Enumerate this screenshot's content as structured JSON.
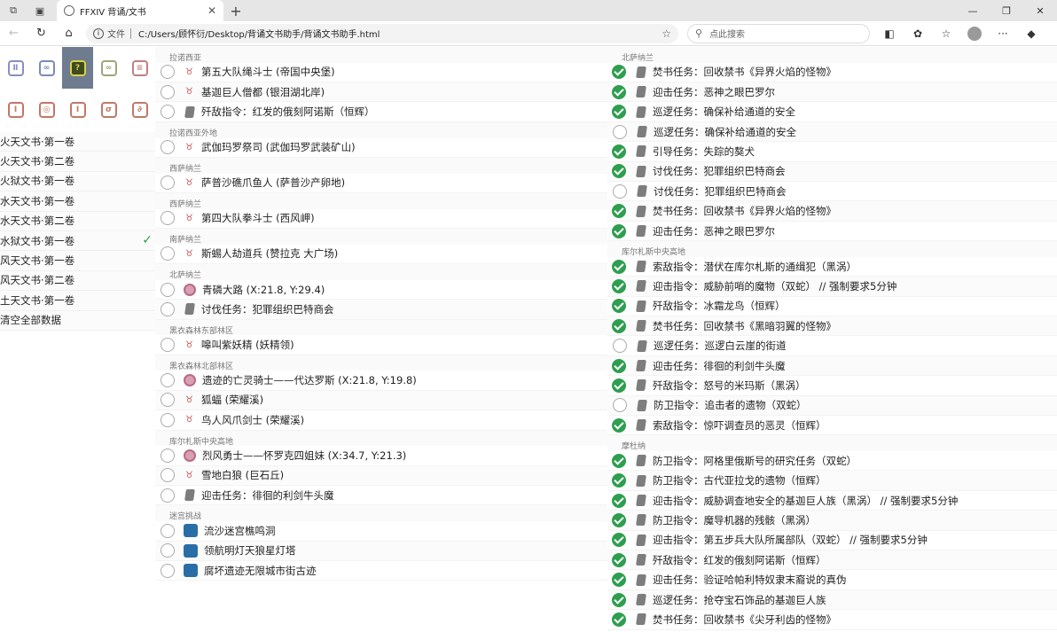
{
  "browser": {
    "tab_title": "FFXIV 背诵/文书",
    "tab_close": "✕",
    "new_tab": "+",
    "address_label": "文件",
    "url": "C:/Users/顾怀衍/Desktop/背诵文书助手/背诵文书助手.html",
    "search_placeholder": "点此搜索"
  },
  "classes_row1": [
    {
      "name": "paladin",
      "glyph": "Ⅱ",
      "color": "#8a8fc0"
    },
    {
      "name": "warrior",
      "glyph": "∞",
      "color": "#7b8ab8"
    },
    {
      "name": "selected",
      "glyph": "?",
      "color": "#d6d24a"
    },
    {
      "name": "gunbreaker",
      "glyph": "∞",
      "color": "#9ca77c"
    },
    {
      "name": "dancer",
      "glyph": "≡",
      "color": "#c08080"
    }
  ],
  "classes_row2": [
    {
      "name": "monk",
      "glyph": "Ⅰ",
      "color": "#c07868"
    },
    {
      "name": "dragoon",
      "glyph": "◎",
      "color": "#c07868"
    },
    {
      "name": "ninja",
      "glyph": "Ⅰ",
      "color": "#c07868"
    },
    {
      "name": "samurai",
      "glyph": "σ",
      "color": "#c07868"
    },
    {
      "name": "reaper",
      "glyph": "∂",
      "color": "#c07868"
    }
  ],
  "documents": [
    {
      "label": "火天文书·第一卷",
      "checked": false
    },
    {
      "label": "火天文书·第二卷",
      "checked": false
    },
    {
      "label": "火狱文书·第一卷",
      "checked": false
    },
    {
      "label": "水天文书·第一卷",
      "checked": false
    },
    {
      "label": "水天文书·第二卷",
      "checked": false
    },
    {
      "label": "水狱文书·第一卷",
      "checked": true
    },
    {
      "label": "风天文书·第一卷",
      "checked": false
    },
    {
      "label": "风天文书·第二卷",
      "checked": false
    },
    {
      "label": "土天文书·第一卷",
      "checked": false
    },
    {
      "label": "清空全部数据",
      "checked": false
    }
  ],
  "check_glyph": "✓",
  "left_column": [
    {
      "zone": "拉诺西亚",
      "items": [
        {
          "done": false,
          "type": "mob",
          "text": "第五大队绳斗士 (帝国中央堡)"
        },
        {
          "done": false,
          "type": "mob",
          "text": "基迦巨人僧都 (银泪湖北岸)"
        },
        {
          "done": false,
          "type": "scroll",
          "text": "歼敌指令：红发的俄刻阿诺斯（恒辉）"
        }
      ]
    },
    {
      "zone": "拉诺西亚外地",
      "items": [
        {
          "done": false,
          "type": "mob",
          "text": "武伽玛罗祭司 (武伽玛罗武装矿山)"
        }
      ]
    },
    {
      "zone": "西萨纳兰",
      "items": [
        {
          "done": false,
          "type": "mob",
          "text": "萨普沙礁爪鱼人 (萨普沙产卵地)"
        }
      ]
    },
    {
      "zone": "西萨纳兰",
      "items": [
        {
          "done": false,
          "type": "mob",
          "text": "第四大队拳斗士 (西风岬)"
        }
      ]
    },
    {
      "zone": "南萨纳兰",
      "items": [
        {
          "done": false,
          "type": "mob",
          "text": "斯蜴人劫道兵 (赞拉克 大广场)"
        }
      ]
    },
    {
      "zone": "北萨纳兰",
      "items": [
        {
          "done": false,
          "type": "fate",
          "text": "青磷大路 (X:21.8, Y:29.4)"
        },
        {
          "done": false,
          "type": "scroll",
          "text": "讨伐任务：犯罪组织巴特商会"
        }
      ]
    },
    {
      "zone": "黑衣森林东部林区",
      "items": [
        {
          "done": false,
          "type": "mob",
          "text": "嗥叫紫妖精 (妖精领)"
        }
      ]
    },
    {
      "zone": "黑衣森林北部林区",
      "items": [
        {
          "done": false,
          "type": "fate",
          "text": "遗迹的亡灵骑士——代达罗斯 (X:21.8, Y:19.8)"
        },
        {
          "done": false,
          "type": "mob",
          "text": "狐蝠 (荣耀溪)"
        },
        {
          "done": false,
          "type": "mob",
          "text": "鸟人风爪剑士 (荣耀溪)"
        }
      ]
    },
    {
      "zone": "库尔札斯中央高地",
      "items": [
        {
          "done": false,
          "type": "fate",
          "text": "烈风勇士——怀罗克四姐妹 (X:34.7, Y:21.3)"
        },
        {
          "done": false,
          "type": "mob",
          "text": "雪地白狼 (巨石丘)"
        },
        {
          "done": false,
          "type": "scroll",
          "text": "迎击任务：徘徊的利剑牛头魔"
        }
      ]
    },
    {
      "zone": "迷宫挑战",
      "items": [
        {
          "done": false,
          "type": "dungeon",
          "text": "流沙迷宫樵鸣洞"
        },
        {
          "done": false,
          "type": "dungeon",
          "text": "领航明灯天狼星灯塔"
        },
        {
          "done": false,
          "type": "dungeon",
          "text": "腐坏遗迹无限城市街古迹"
        }
      ]
    }
  ],
  "right_column": [
    {
      "zone": "北萨纳兰",
      "items": [
        {
          "done": true,
          "type": "scroll",
          "text": "焚书任务：回收禁书《异界火焰的怪物》"
        },
        {
          "done": true,
          "type": "scroll",
          "text": "迎击任务：恶神之眼巴罗尔"
        },
        {
          "done": true,
          "type": "scroll",
          "text": "巡逻任务：确保补给通道的安全"
        },
        {
          "done": false,
          "type": "scroll",
          "text": "巡逻任务：确保补给通道的安全"
        },
        {
          "done": true,
          "type": "scroll",
          "text": "引导任务：失踪的獒犬"
        },
        {
          "done": true,
          "type": "scroll",
          "text": "讨伐任务：犯罪组织巴特商会"
        },
        {
          "done": false,
          "type": "scroll",
          "text": "讨伐任务：犯罪组织巴特商会"
        },
        {
          "done": true,
          "type": "scroll",
          "text": "焚书任务：回收禁书《异界火焰的怪物》"
        },
        {
          "done": true,
          "type": "scroll",
          "text": "迎击任务：恶神之眼巴罗尔"
        }
      ]
    },
    {
      "zone": "库尔札斯中央高地",
      "items": [
        {
          "done": true,
          "type": "scroll",
          "text": "索敌指令：潜伏在库尔札斯的通缉犯（黑涡）"
        },
        {
          "done": true,
          "type": "scroll",
          "text": "迎击指令：威胁前哨的魔物（双蛇） // 强制要求5分钟"
        },
        {
          "done": true,
          "type": "scroll",
          "text": "歼敌指令：冰霜龙鸟（恒辉）"
        },
        {
          "done": true,
          "type": "scroll",
          "text": "焚书任务：回收禁书《黑暗羽翼的怪物》"
        },
        {
          "done": false,
          "type": "scroll",
          "text": "巡逻任务：巡逻白云崖的街道"
        },
        {
          "done": true,
          "type": "scroll",
          "text": "迎击任务：徘徊的利剑牛头魔"
        },
        {
          "done": true,
          "type": "scroll",
          "text": "歼敌指令：怒号的米玛斯（黑涡）"
        },
        {
          "done": false,
          "type": "scroll",
          "text": "防卫指令：追击者的遗物（双蛇）"
        },
        {
          "done": true,
          "type": "scroll",
          "text": "索敌指令：惊吓调查员的恶灵（恒辉）"
        }
      ]
    },
    {
      "zone": "摩杜纳",
      "items": [
        {
          "done": true,
          "type": "scroll",
          "text": "防卫指令：阿格里俄斯号的研究任务（双蛇）"
        },
        {
          "done": true,
          "type": "scroll",
          "text": "防卫指令：古代亚拉戈的遗物（恒辉）"
        },
        {
          "done": true,
          "type": "scroll",
          "text": "迎击指令：威胁调查地安全的基迦巨人族（黑涡） // 强制要求5分钟"
        },
        {
          "done": true,
          "type": "scroll",
          "text": "防卫指令：魔导机器的残骸（黑涡）"
        },
        {
          "done": true,
          "type": "scroll",
          "text": "迎击指令：第五步兵大队所属部队（双蛇） // 强制要求5分钟"
        },
        {
          "done": true,
          "type": "scroll",
          "text": "歼敌指令：红发的俄刻阿诺斯（恒辉）"
        },
        {
          "done": true,
          "type": "scroll",
          "text": "迎击任务：验证哈帕利特奴隶末裔说的真伪"
        },
        {
          "done": true,
          "type": "scroll",
          "text": "巡逻任务：抢夺宝石饰品的基迦巨人族"
        },
        {
          "done": true,
          "type": "scroll",
          "text": "焚书任务：回收禁书《尖牙利齿的怪物》"
        }
      ]
    }
  ]
}
